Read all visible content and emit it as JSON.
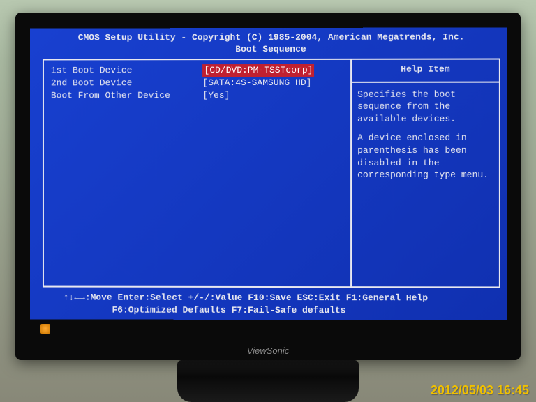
{
  "header": {
    "title_line1": "CMOS Setup Utility - Copyright (C) 1985-2004, American Megatrends, Inc.",
    "title_line2": "Boot Sequence"
  },
  "settings": {
    "row1_label": "1st Boot Device",
    "row1_value": "[CD/DVD:PM-TSSTcorp]",
    "row2_label": "2nd Boot Device",
    "row2_value": "[SATA:4S-SAMSUNG HD]",
    "row3_label": "Boot From Other Device",
    "row3_value": "[Yes]"
  },
  "help": {
    "header": "Help Item",
    "body_para1": "Specifies the boot sequence from the available devices.",
    "body_para2": "A device enclosed in parenthesis has been disabled in the corresponding type menu."
  },
  "footer": {
    "line1": "↑↓←→:Move   Enter:Select  +/-/:Value  F10:Save  ESC:Exit  F1:General Help",
    "line2": "F6:Optimized Defaults          F7:Fail-Safe defaults"
  },
  "photo": {
    "timestamp": "2012/05/03 16:45",
    "monitor_brand": "ViewSonic"
  }
}
